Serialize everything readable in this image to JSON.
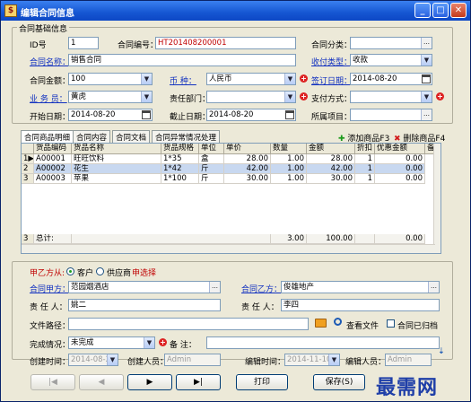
{
  "window": {
    "title": "编辑合同信息",
    "app_icon": "contract-app-icon"
  },
  "basic": {
    "group_title": "合同基础信息",
    "id_label": "ID号",
    "id_value": "1",
    "contract_no_label": "合同编号：",
    "contract_no_value": "HT201408200001",
    "category_label": "合同分类：",
    "category_value": "",
    "name_label": "合同名称：",
    "name_value": "销售合同",
    "pay_type_label": "收付类型：",
    "pay_type_value": "收款",
    "amount_label": "合同金额：",
    "amount_value": "100",
    "currency_label": "币    种：",
    "currency_value": "人民币",
    "sign_date_label": "签订日期：",
    "sign_date_value": "2014-08-20",
    "salesman_label": "业 务 员：",
    "salesman_value": "黄虎",
    "dept_label": "责任部门：",
    "dept_value": "",
    "pay_method_label": "支付方式：",
    "pay_method_value": "",
    "start_label": "开始日期：",
    "start_value": "2014-08-20",
    "end_label": "截止日期：",
    "end_value": "2014-08-20",
    "project_label": "所属项目：",
    "project_value": ""
  },
  "tabs": [
    "合同商品明细",
    "合同内容",
    "合同文档",
    "合同异常情况处理"
  ],
  "actions": {
    "add": "添加商品F3",
    "delete": "删除商品F4"
  },
  "grid": {
    "headers": [
      "",
      "货品编码",
      "货品名称",
      "货品规格",
      "单位",
      "单价",
      "数量",
      "金额",
      "折扣",
      "优惠金额",
      "备"
    ],
    "rows": [
      {
        "idx": "1",
        "code": "A00001",
        "name": "旺旺饮料",
        "spec": "1*35",
        "unit": "盒",
        "price": "28.00",
        "qty": "1.00",
        "amount": "28.00",
        "disc": "1",
        "off": "0.00"
      },
      {
        "idx": "2",
        "code": "A00002",
        "name": "花生",
        "spec": "1*42",
        "unit": "斤",
        "price": "42.00",
        "qty": "1.00",
        "amount": "42.00",
        "disc": "1",
        "off": "0.00"
      },
      {
        "idx": "3",
        "code": "A00003",
        "name": "苹果",
        "spec": "1*100",
        "unit": "斤",
        "price": "30.00",
        "qty": "1.00",
        "amount": "30.00",
        "disc": "1",
        "off": "0.00"
      }
    ],
    "footer": {
      "idx": "3",
      "label": "总计:",
      "qty": "3.00",
      "amount": "100.00",
      "off": "0.00"
    }
  },
  "party": {
    "from_label": "甲乙方从:",
    "opt_customer": "客户",
    "opt_supplier": "供应商",
    "hint": "申选择",
    "party_a_label": "合同甲方：",
    "party_a_value": "范园烟酒店",
    "party_b_label": "合同乙方：",
    "party_b_value": "俊雄地产",
    "resp_a_label": "责 任 人：",
    "resp_a_value": "姚二",
    "resp_b_label": "责 任 人：",
    "resp_b_value": "李四",
    "file_label": "文件路径：",
    "file_value": "",
    "view_file": "查看文件",
    "archived": "合同已归档",
    "status_label": "完成情况：",
    "status_value": "未完成",
    "remark_label": "备    注：",
    "remark_value": "",
    "created_time_label": "创建时间：",
    "created_time_value": "2014-08-20",
    "creator_label": "创建人员：",
    "creator_value": "Admin",
    "edit_time_label": "编辑时间：",
    "edit_time_value": "2014-11-10",
    "editor_label": "编辑人员：",
    "editor_value": "Admin"
  },
  "nav": {
    "first": "|◀",
    "prev": "◀",
    "next": "▶",
    "last": "▶|",
    "print": "打印",
    "save": "保存(S)"
  },
  "watermark": "最需网"
}
